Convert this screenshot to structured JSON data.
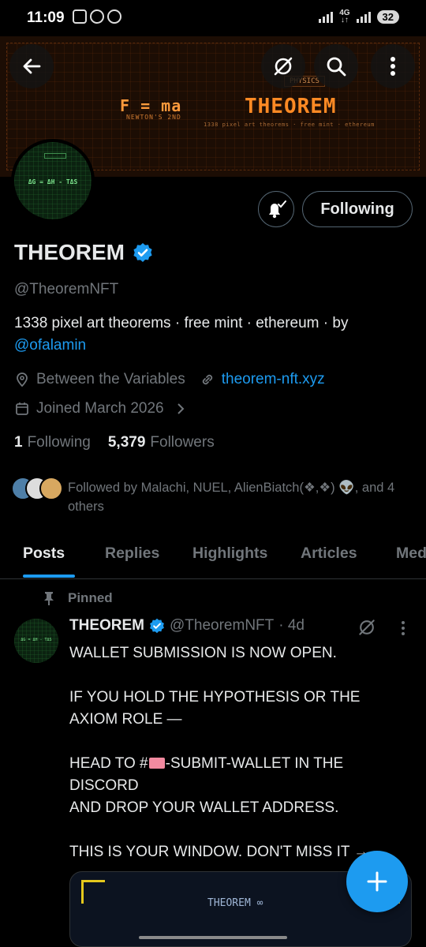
{
  "status_bar": {
    "time": "11:09",
    "network": "4G",
    "battery": "32"
  },
  "banner": {
    "formula": "F = ma",
    "formula_caption": "NEWTON'S 2ND",
    "category": "PHYSICS",
    "title": "THEOREM",
    "subtitle": "1338 pixel art theorems · free mint · ethereum"
  },
  "avatar": {
    "formula": "ΔG = ΔH - TΔS"
  },
  "actions": {
    "following_label": "Following"
  },
  "profile": {
    "name": "THEOREM",
    "handle": "@TheoremNFT",
    "bio_text": "1338 pixel art theorems · free mint · ethereum · by",
    "bio_link": "@ofalamin",
    "location": "Between the Variables",
    "website": "theorem-nft.xyz",
    "joined": "Joined March 2026",
    "following_count": "1",
    "following_label": "Following",
    "followers_count": "5,379",
    "followers_label": "Followers",
    "followed_by": "Followed by Malachi, NUEL, AlienBiatch(❖,❖) 👽, and 4 others"
  },
  "tabs": [
    {
      "label": "Posts",
      "active": true
    },
    {
      "label": "Replies"
    },
    {
      "label": "Highlights"
    },
    {
      "label": "Articles"
    },
    {
      "label": "Media"
    }
  ],
  "post": {
    "pinned_label": "Pinned",
    "author_name": "THEOREM",
    "author_handle": "@TheoremNFT",
    "age": "· 4d",
    "avatar_text": "ΔG = ΔH - TΔS",
    "body_1": "WALLET SUBMISSION IS NOW OPEN.\n\nIF YOU HOLD THE HYPOTHESIS OR THE AXIOM ROLE —\n\nHEAD TO #",
    "body_2": "-SUBMIT-WALLET  IN THE DISCORD\nAND DROP YOUR WALLET ADDRESS.\n\nTHIS IS YOUR WINDOW. DON'T MISS IT →",
    "media_title": "THEOREM ∞"
  },
  "colors": {
    "accent": "#1d9bf0",
    "muted": "#71767b",
    "banner_orange": "#ff8a24"
  }
}
